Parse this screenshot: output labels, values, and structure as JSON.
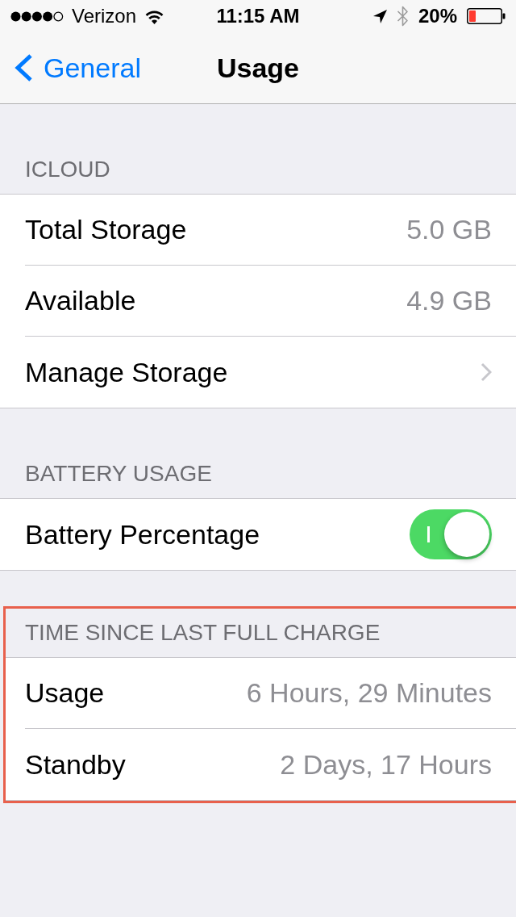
{
  "status_bar": {
    "carrier": "Verizon",
    "time": "11:15 AM",
    "battery": "20%"
  },
  "nav_bar": {
    "back_label": "General",
    "title": "Usage"
  },
  "sections": [
    {
      "header": "ICLOUD",
      "highlighted": false,
      "rows": [
        {
          "kind": "value",
          "label": "Total Storage",
          "value": "5.0 GB"
        },
        {
          "kind": "value",
          "label": "Available",
          "value": "4.9 GB"
        },
        {
          "kind": "link",
          "label": "Manage Storage"
        }
      ]
    },
    {
      "header": "BATTERY USAGE",
      "highlighted": false,
      "rows": [
        {
          "kind": "toggle",
          "label": "Battery Percentage",
          "on": true
        }
      ]
    },
    {
      "header": "TIME SINCE LAST FULL CHARGE",
      "highlighted": true,
      "rows": [
        {
          "kind": "value",
          "label": "Usage",
          "value": "6 Hours, 29 Minutes"
        },
        {
          "kind": "value",
          "label": "Standby",
          "value": "2 Days, 17 Hours"
        }
      ]
    }
  ]
}
